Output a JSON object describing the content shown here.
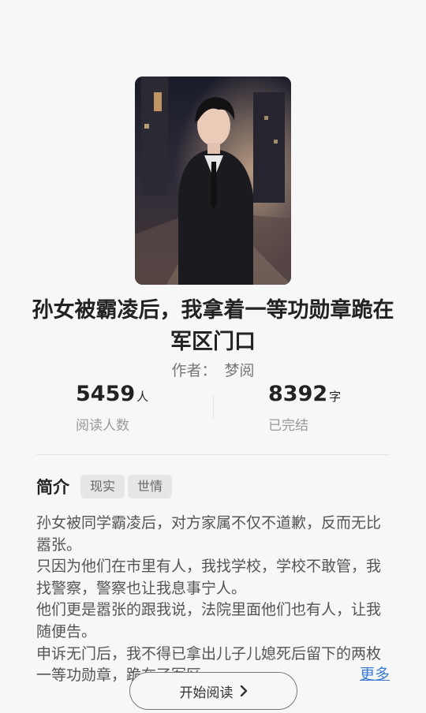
{
  "book": {
    "title": "孙女被霸凌后，我拿着一等功勋章跪在军区门口",
    "author_label": "作者：",
    "author": "梦阅"
  },
  "stats": {
    "readers": {
      "value": "5459",
      "unit": "人",
      "label": "阅读人数"
    },
    "words": {
      "value": "8392",
      "unit": "字",
      "label": "已完结"
    }
  },
  "intro": {
    "heading": "简介",
    "tags": [
      "现实",
      "世情"
    ],
    "text": "孙女被同学霸凌后，对方家属不仅不道歉，反而无比嚣张。\n只因为他们在市里有人，我找学校，学校不敢管，我找警察，警察也让我息事宁人。\n他们更是嚣张的跟我说，法院里面他们也有人，让我随便告。\n申诉无门后，我不得已拿出儿子儿媳死后留下的两枚一等功勋章，跪在了军区...",
    "more_label": "更多"
  },
  "actions": {
    "start_label": "开始阅读"
  },
  "icons": {
    "start_chevron": "chevron-right-icon"
  }
}
